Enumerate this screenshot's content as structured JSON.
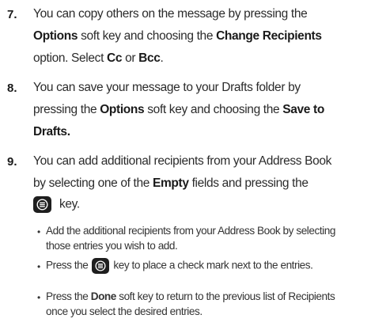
{
  "steps": [
    {
      "number": "7.",
      "lines": [
        [
          "You can copy others on the message by pressing the"
        ],
        [
          "",
          "Options",
          " soft key and choosing the ",
          "Change Recipients",
          ""
        ],
        [
          "option. Select ",
          "Cc",
          " or ",
          "Bcc",
          "."
        ]
      ]
    },
    {
      "number": "8.",
      "lines": [
        [
          "You can save your message to your Drafts folder by"
        ],
        [
          "pressing the ",
          "Options",
          " soft key and choosing the ",
          "Save to",
          ""
        ],
        [
          "",
          "Drafts.",
          ""
        ]
      ]
    },
    {
      "number": "9.",
      "lines": [
        [
          "You can add additional recipients from your Address Book"
        ],
        [
          "by selecting one of the ",
          "Empty",
          " fields and pressing the"
        ],
        [
          " key."
        ]
      ]
    }
  ],
  "bullets": [
    {
      "lines": [
        "Add the additional recipients from your Address Book by selecting",
        "those entries you wish to add."
      ]
    },
    {
      "pre": "Press the",
      "post": "key to place a check mark next to the entries."
    },
    {
      "line1_pre": "Press the ",
      "line1_bold": "Done",
      "line1_post": " soft key to return to the previous list of Recipients",
      "line2": "once you select the desired entries."
    }
  ],
  "icons": {
    "key": "ok-key-icon"
  }
}
